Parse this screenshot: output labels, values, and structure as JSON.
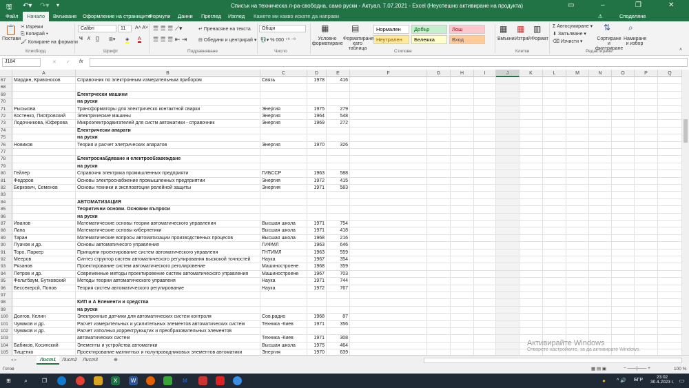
{
  "window": {
    "title": "Списък на техническа л-ра-свободна, само руски - Актуал. 7.07.2021 - Excel (Неуспешно активиране на продукта)",
    "share": "Споделяне"
  },
  "tabs": [
    "Файл",
    "Начало",
    "Вмъкване",
    "Оформление на страниците",
    "Формули",
    "Данни",
    "Преглед",
    "Изглед"
  ],
  "tell_me": "Кажете ми какво искате да направи",
  "ribbon": {
    "clipboard": {
      "paste": "Постави",
      "cut": "Изрежи",
      "copy": "Копирай",
      "format_painter": "Копиране на формати",
      "label": "Клипборд"
    },
    "font": {
      "name": "Calibri",
      "size": "11",
      "bold": "Ч",
      "italic": "К",
      "underline": "П",
      "label": "Шрифт"
    },
    "alignment": {
      "wrap": "Пренасяне на текста",
      "merge": "Обедини и центрирай",
      "label": "Подравняване"
    },
    "number": {
      "format": "Общи",
      "percent": "%",
      "thousands": "000",
      "label": "Число"
    },
    "styles": {
      "conditional": "Условно форматиране",
      "as_table": "Форматиране като таблица",
      "label": "Стилове",
      "cells": [
        {
          "name": "Нормален",
          "bg": "#ffffff",
          "fg": "#000000"
        },
        {
          "name": "Добър",
          "bg": "#c6efce",
          "fg": "#006100"
        },
        {
          "name": "Лош",
          "bg": "#ffc7ce",
          "fg": "#9c0006"
        },
        {
          "name": "Неутрален",
          "bg": "#ffeb9c",
          "fg": "#9c5700"
        },
        {
          "name": "Бележка",
          "bg": "#ffffcc",
          "fg": "#000000"
        },
        {
          "name": "Вход",
          "bg": "#ffcc99",
          "fg": "#3f3f76"
        }
      ]
    },
    "cells": {
      "insert": "Вмъкни",
      "delete": "Изтрий",
      "format": "Формат",
      "label": "Клетки"
    },
    "editing": {
      "autosum": "Автосумиране",
      "fill": "Запълване",
      "clear": "Изчисти",
      "sort": "Сортиране и филтриране",
      "find": "Намиране и избор",
      "label": "Редактиране"
    }
  },
  "formula_bar": {
    "name_box": "J184",
    "fx": "fx",
    "value": ""
  },
  "columns": [
    "A",
    "B",
    "C",
    "D",
    "E",
    "F",
    "G",
    "H",
    "I",
    "J",
    "K",
    "L",
    "M",
    "N",
    "O",
    "P",
    "Q"
  ],
  "selected_column": "J",
  "rows": [
    [
      "67",
      "Мардин, Кривоносов",
      "Справочник по электронным измерательным прибором",
      "Связь",
      "1978",
      "416",
      0
    ],
    [
      "68",
      "",
      "",
      "",
      "",
      "",
      0
    ],
    [
      "69",
      "",
      "Електрчески машини",
      "",
      "",
      "",
      1
    ],
    [
      "70",
      "",
      "на руски",
      "",
      "",
      "",
      1
    ],
    [
      "71",
      "Рыськова",
      "Трансформаторы для электрическо контактной сварки",
      "Энергия",
      "1975",
      "279",
      0
    ],
    [
      "72",
      "Костенко, Пиотровский",
      "Электрические машины",
      "Энергия",
      "1964",
      "548",
      0
    ],
    [
      "73",
      "Лодочникова, Юферова",
      "Микроэлектродвигателей для систм автоматики - справочник",
      "Энергия",
      "1969",
      "272",
      0
    ],
    [
      "74",
      "",
      "Електрически апарати",
      "",
      "",
      "",
      1
    ],
    [
      "75",
      "",
      "на руски",
      "",
      "",
      "",
      1
    ],
    [
      "76",
      "Новиков",
      "Теория и расчет элетрических апаратов",
      "Энергия",
      "1970",
      "326",
      0
    ],
    [
      "77",
      "",
      "",
      "",
      "",
      "",
      0
    ],
    [
      "78",
      "",
      "Електроснабдяване и електрообзавеждане",
      "",
      "",
      "",
      1
    ],
    [
      "79",
      "",
      "на руски",
      "",
      "",
      "",
      1
    ],
    [
      "80",
      "Гейлер",
      "Справочнк электрика промишленных предприяти",
      "ГИБССР",
      "1963",
      "588",
      0
    ],
    [
      "81",
      "Федоров",
      "Основы электроснабжение промышленных предприятии",
      "Энергия",
      "1972",
      "415",
      0
    ],
    [
      "82",
      "Беркович, Семенов",
      "Основы техники и эксплоатоции релейной защиты",
      "Энергия",
      "1971",
      "583",
      0
    ],
    [
      "83",
      "",
      "",
      "",
      "",
      "",
      0
    ],
    [
      "84",
      "",
      "АВТОМАТИЗАЦИЯ",
      "",
      "",
      "",
      1
    ],
    [
      "85",
      "",
      "Теоритични основи. Основни въпроси",
      "",
      "",
      "",
      1
    ],
    [
      "86",
      "",
      "на руски",
      "",
      "",
      "",
      1
    ],
    [
      "87",
      "Иванов",
      "Математические основы теории автоматического управления",
      "Высшая школа",
      "1971",
      "754",
      0
    ],
    [
      "88",
      "Лапа",
      "Математические основы кибернетики",
      "Высшая школа",
      "1971",
      "418",
      0
    ],
    [
      "89",
      "Таран",
      "Математические вопросы автоматизации производственых процесов",
      "Высшая школа",
      "1968",
      "216",
      0
    ],
    [
      "90",
      "Пуачов и др.",
      "Основы автоматичесого управления",
      "ГИФМЛ",
      "1963",
      "646",
      0
    ],
    [
      "91",
      "Торо, Паркер",
      "Принципи проектирование систем автоматического управленя",
      "ГНТИМЛ",
      "1963",
      "559",
      0
    ],
    [
      "92",
      "Мееров",
      "Синтез структор систем автоматического регулирования выскокой точностей",
      "Наука",
      "1967",
      "354",
      0
    ],
    [
      "93",
      "Рязанов",
      "Проектирование систем автоматического реголировение",
      "Машиностроене",
      "1968",
      "359",
      0
    ],
    [
      "94",
      "Петров и др.",
      "Современные методы проектировение систем автоматического управления",
      "Машиностроене",
      "1967",
      "703",
      0
    ],
    [
      "95",
      "Фельтбаум, Бутковский",
      "Методы теории автоматического управленя",
      "Наука",
      "1971",
      "744",
      0
    ],
    [
      "96",
      "Бессекерсй, Попов",
      "Теория систем автоматического регулирование",
      "Наука",
      "1972",
      "767",
      0
    ],
    [
      "97",
      "",
      "",
      "",
      "",
      "",
      0
    ],
    [
      "98",
      "",
      "КИП и А Елементи и средства",
      "",
      "",
      "",
      1
    ],
    [
      "99",
      "",
      "на руски",
      "",
      "",
      "",
      1
    ],
    [
      "100",
      "Долгов, Келин",
      "Электронные датчики для автоматических систем контроля",
      "Сов.радио",
      "1968",
      "87",
      0
    ],
    [
      "101",
      "Чумаков и др.",
      "Расчет измерительных и усилительных элементов автоматических систем",
      "Техника -Киев",
      "1971",
      "356",
      0
    ],
    [
      "102",
      "Чумаков и др.",
      "Расчет изполных,коррект‌рующтих и преобразовательных  элементов",
      "",
      "",
      "",
      0
    ],
    [
      "103",
      "",
      "автоматических систем",
      "Техника -Киев",
      "1971",
      "308",
      0
    ],
    [
      "104",
      "Бабиков, Косинский",
      "Элементы и устройства автоматики",
      "Высшая школа",
      "1975",
      "464",
      0
    ],
    [
      "105",
      "Тищенко",
      "Проектирование магнитных и полупроводниковых элементов автоматики",
      "Энергия",
      "1970",
      "639",
      0
    ]
  ],
  "sheets": [
    "Лист1",
    "Лист2",
    "Лист3"
  ],
  "status": {
    "ready": "Готов",
    "zoom": "100 %"
  },
  "watermark": {
    "title": "Активирайте Windows",
    "sub": "Отворете настройките, за да активирате Windows."
  },
  "taskbar": {
    "lang": "БГР",
    "time": "23:02",
    "date": "30.4.2023 г."
  }
}
